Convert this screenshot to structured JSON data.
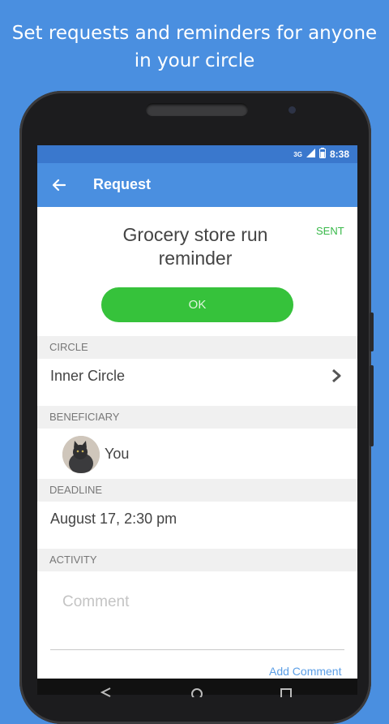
{
  "promo": {
    "headline_line1": "Set requests and reminders for anyone",
    "headline_line2": "in your circle"
  },
  "status_bar": {
    "network": "3G",
    "time": "8:38"
  },
  "app_bar": {
    "back_icon": "arrow-left-icon",
    "title": "Request"
  },
  "request": {
    "title": "Grocery store run reminder",
    "status": "SENT",
    "ok_label": "OK"
  },
  "circle": {
    "header": "CIRCLE",
    "value": "Inner Circle",
    "chevron_icon": "chevron-right-icon"
  },
  "beneficiary": {
    "header": "BENEFICIARY",
    "name": "You",
    "avatar": "cat-photo-avatar"
  },
  "deadline": {
    "header": "DEADLINE",
    "value": "August 17, 2:30 pm"
  },
  "activity": {
    "header": "ACTIVITY",
    "comment_placeholder": "Comment",
    "add_comment_label": "Add Comment"
  },
  "colors": {
    "background": "#4a8fe0",
    "app_bar": "#4a8fe0",
    "status_bar": "#3a78cd",
    "ok_button": "#36c23b",
    "sent_status": "#39b94a",
    "link": "#5a9ee6"
  }
}
